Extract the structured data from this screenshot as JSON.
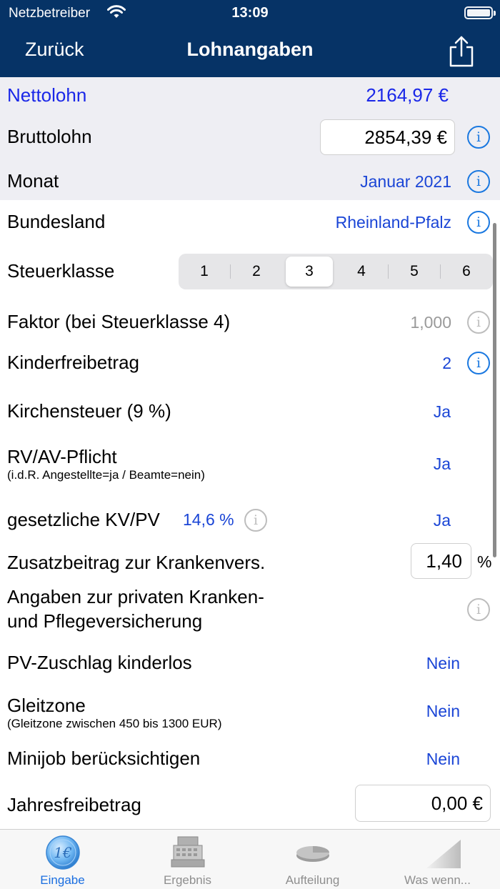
{
  "status": {
    "carrier": "Netzbetreiber",
    "time": "13:09"
  },
  "nav": {
    "back": "Zurück",
    "title": "Lohnangaben"
  },
  "net": {
    "label": "Nettolohn",
    "value": "2164,97 €"
  },
  "gross": {
    "label": "Bruttolohn",
    "value": "2854,39 €"
  },
  "month": {
    "label": "Monat",
    "value": "Januar 2021"
  },
  "state": {
    "label": "Bundesland",
    "value": "Rheinland-Pfalz"
  },
  "taxclass": {
    "label": "Steuerklasse",
    "options": [
      "1",
      "2",
      "3",
      "4",
      "5",
      "6"
    ],
    "selected": "3"
  },
  "factor": {
    "label": "Faktor (bei Steuerklasse 4)",
    "value": "1,000"
  },
  "childallowance": {
    "label": "Kinderfreibetrag",
    "value": "2"
  },
  "churchtax": {
    "label": "Kirchensteuer (9 %)",
    "value": "Ja"
  },
  "rvav": {
    "label": "RV/AV-Pflicht",
    "sublabel": "(i.d.R. Angestellte=ja / Beamte=nein)",
    "value": "Ja"
  },
  "kvpv": {
    "label": "gesetzliche KV/PV",
    "rate": "14,6 %",
    "value": "Ja"
  },
  "extra": {
    "label": "Zusatzbeitrag zur Krankenvers.",
    "value": "1,40",
    "unit": "%"
  },
  "private": {
    "line1": "Angaben zur privaten Kranken-",
    "line2": "und Pflegeversicherung"
  },
  "pvsurcharge": {
    "label": "PV-Zuschlag kinderlos",
    "value": "Nein"
  },
  "glide": {
    "label": "Gleitzone",
    "sublabel": "(Gleitzone zwischen 450 bis 1300 EUR)",
    "value": "Nein"
  },
  "minijob": {
    "label": "Minijob berücksichtigen",
    "value": "Nein"
  },
  "annual": {
    "label": "Jahresfreibetrag",
    "value": "0,00 €"
  },
  "tabs": [
    {
      "label": "Eingabe",
      "icon": "euro-coin-icon"
    },
    {
      "label": "Ergebnis",
      "icon": "cash-register-icon"
    },
    {
      "label": "Aufteilung",
      "icon": "pie-chart-icon"
    },
    {
      "label": "Was wenn...",
      "icon": "ramp-chart-icon"
    }
  ],
  "colors": {
    "navbar": "#063366",
    "accent": "#1a27e8",
    "info": "#1a78e0"
  }
}
